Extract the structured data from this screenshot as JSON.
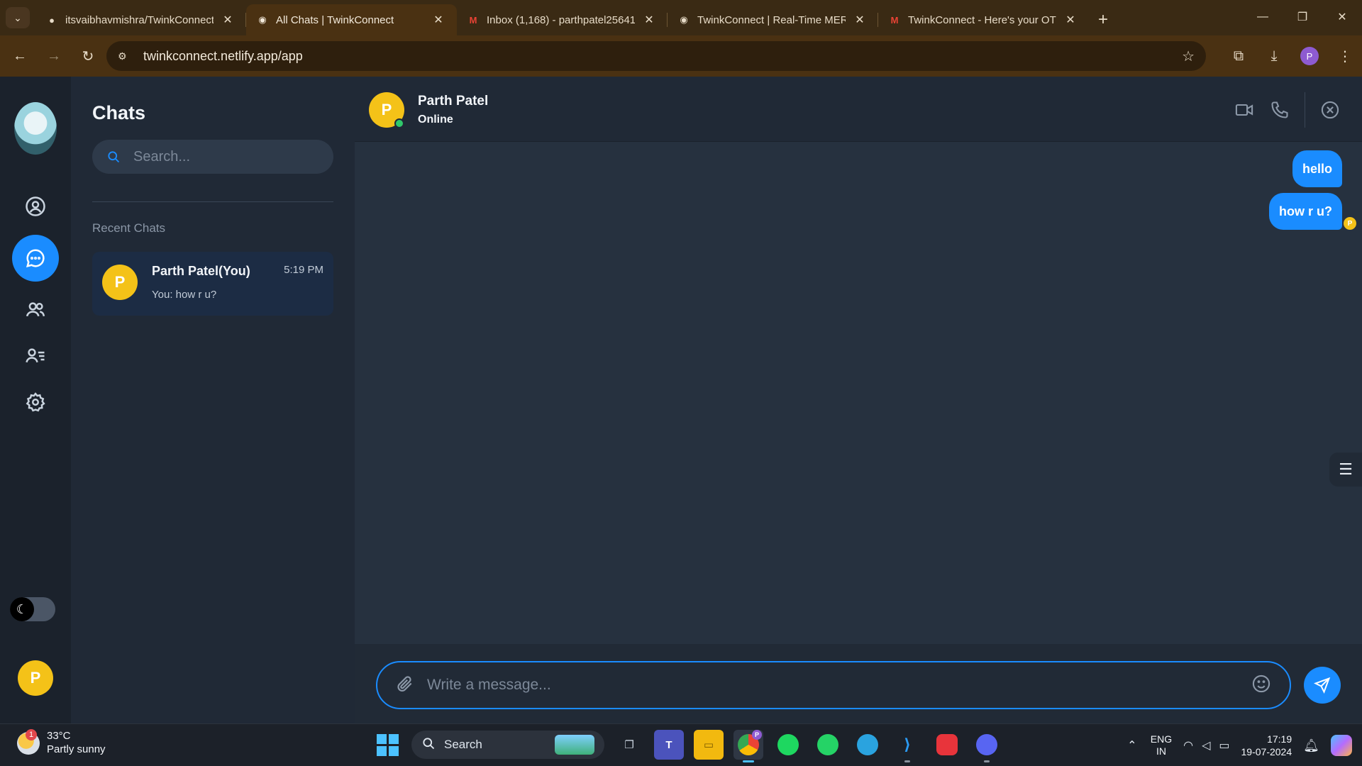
{
  "browser": {
    "tabs": [
      {
        "title": "itsvaibhavmishra/TwinkConnect",
        "icon": "github-icon",
        "active": false
      },
      {
        "title": "All Chats | TwinkConnect",
        "icon": "twinkconnect-icon",
        "active": true
      },
      {
        "title": "Inbox (1,168) - parthpatel25641",
        "icon": "gmail-icon",
        "active": false
      },
      {
        "title": "TwinkConnect | Real-Time MERN",
        "icon": "twinkconnect-icon",
        "active": false
      },
      {
        "title": "TwinkConnect - Here's your OTP",
        "icon": "gmail-icon",
        "active": false
      }
    ],
    "new_tab": "+",
    "url": "twinkconnect.netlify.app/app",
    "profile_initial": "P"
  },
  "sidebar": {
    "nav": [
      {
        "name": "profile",
        "icon": "user-circle-icon"
      },
      {
        "name": "chats",
        "icon": "chat-bubble-icon",
        "active": true
      },
      {
        "name": "groups",
        "icon": "users-icon"
      },
      {
        "name": "contacts",
        "icon": "contact-list-icon"
      },
      {
        "name": "settings",
        "icon": "gear-icon"
      }
    ],
    "theme_toggle_icon": "moon-icon",
    "user_initial": "P"
  },
  "chat_list": {
    "title": "Chats",
    "search_placeholder": "Search...",
    "recent_label": "Recent Chats",
    "items": [
      {
        "initial": "P",
        "name": "Parth Patel(You)",
        "time": "5:19 PM",
        "preview": "You: how r u?"
      }
    ]
  },
  "conversation": {
    "contact_initial": "P",
    "contact_name": "Parth Patel",
    "status": "Online",
    "messages": [
      {
        "text": "hello",
        "from": "me"
      },
      {
        "text": "how r u?",
        "from": "me"
      }
    ],
    "read_receipt_initial": "P",
    "composer_placeholder": "Write a message..."
  },
  "taskbar": {
    "weather_badge": "1",
    "temperature": "33°C",
    "condition": "Partly sunny",
    "search_label": "Search",
    "chrome_badge": "P",
    "lang_top": "ENG",
    "lang_bottom": "IN",
    "time": "17:19",
    "date": "19-07-2024"
  },
  "colors": {
    "accent": "#1a8cff",
    "avatar": "#f4c218",
    "online": "#30c96b",
    "browser_frame": "#4a3112"
  }
}
